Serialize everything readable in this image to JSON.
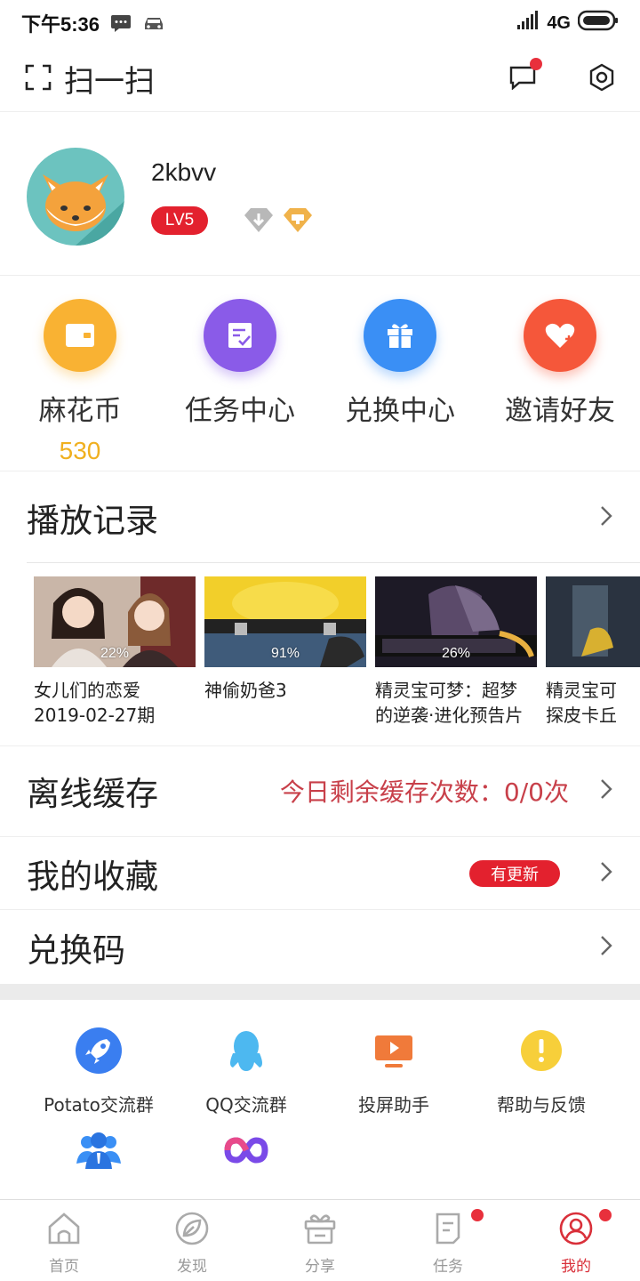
{
  "status_bar": {
    "time": "下午5:36",
    "network": "4G",
    "icons": [
      "message-icon",
      "car-icon",
      "signal-icon",
      "battery-icon"
    ]
  },
  "top_bar": {
    "scan_label": "扫一扫",
    "icons": [
      "scan-icon",
      "message-icon",
      "settings-icon"
    ]
  },
  "profile": {
    "username": "2kbvv",
    "level": "LV5"
  },
  "quick_actions": [
    {
      "label": "麻花币",
      "value": "530",
      "icon": "wallet-icon",
      "color": "#f9b233"
    },
    {
      "label": "任务中心",
      "icon": "task-icon",
      "color": "#8a5be8"
    },
    {
      "label": "兑换中心",
      "icon": "gift-icon",
      "color": "#3a8ff5"
    },
    {
      "label": "邀请好友",
      "icon": "heart-plus-icon",
      "color": "#f5573a"
    }
  ],
  "history": {
    "title": "播放记录",
    "items": [
      {
        "title": "女儿们的恋爱\n2019-02-27期",
        "progress": "22%"
      },
      {
        "title": "神偷奶爸3",
        "progress": "91%"
      },
      {
        "title": "精灵宝可梦：超梦\n的逆袭·进化预告片",
        "progress": "26%"
      },
      {
        "title": "精灵宝可\n探皮卡丘",
        "progress": ""
      }
    ]
  },
  "offline": {
    "title": "离线缓存",
    "note": "今日剩余缓存次数：0/0次"
  },
  "favorites": {
    "title": "我的收藏",
    "badge": "有更新"
  },
  "redeem": {
    "title": "兑换码"
  },
  "tools": [
    {
      "label": "Potato交流群",
      "icon": "rocket-icon"
    },
    {
      "label": "QQ交流群",
      "icon": "qq-penguin-icon"
    },
    {
      "label": "投屏助手",
      "icon": "cast-screen-icon"
    },
    {
      "label": "帮助与反馈",
      "icon": "help-icon"
    }
  ],
  "extra_tools": [
    {
      "icon": "group-icon"
    },
    {
      "icon": "infinity-icon"
    }
  ],
  "bottom_nav": [
    {
      "label": "首页",
      "icon": "home-icon",
      "active": false,
      "dot": false
    },
    {
      "label": "发现",
      "icon": "discover-icon",
      "active": false,
      "dot": false
    },
    {
      "label": "分享",
      "icon": "share-icon",
      "active": false,
      "dot": false
    },
    {
      "label": "任务",
      "icon": "task-nav-icon",
      "active": false,
      "dot": true
    },
    {
      "label": "我的",
      "icon": "profile-icon",
      "active": true,
      "dot": true
    }
  ],
  "colors": {
    "accent_red": "#e3212e",
    "coin_yellow": "#f0b020",
    "note_red": "#c8404a"
  }
}
